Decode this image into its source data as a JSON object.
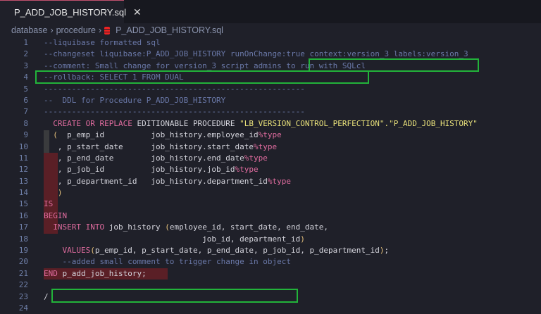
{
  "tab": {
    "title": "P_ADD_JOB_HISTORY.sql",
    "close": "✕"
  },
  "breadcrumb": [
    "database",
    "procedure",
    "P_ADD_JOB_HISTORY.sql"
  ],
  "lines": [
    [
      [
        "--liquibase formatted sql",
        "cm"
      ]
    ],
    [
      [
        "--changeset liquibase:P_ADD_JOB_HISTORY runOnChange:true context:version_3 labels:version_3",
        "cm"
      ]
    ],
    [
      [
        "--comment: Small change for version_3 script admins to run with SQLcl",
        "cm"
      ]
    ],
    [
      [
        "--rollback: SELECT 1 FROM DUAL",
        "cm"
      ]
    ],
    [
      [
        "--------------------------------------------------------",
        "cm"
      ]
    ],
    [
      [
        "--  DDL for Procedure P_ADD_JOB_HISTORY",
        "cm"
      ]
    ],
    [
      [
        "--------------------------------------------------------",
        "cm"
      ]
    ],
    [
      [
        "  ",
        "tx"
      ],
      [
        "CREATE OR REPLACE ",
        "kw"
      ],
      [
        "EDITIONABLE PROCEDURE ",
        "tx"
      ],
      [
        "\"LB_VERSION_CONTROL_PERFECTION\".\"P_ADD_JOB_HISTORY\"",
        "str"
      ]
    ],
    [
      [
        "  ",
        "tx"
      ],
      [
        "(",
        "pn"
      ],
      [
        "  p_emp_id          job_history.employee_id",
        "tx"
      ],
      [
        "%type",
        "kw"
      ]
    ],
    [
      [
        "   , p_start_date      job_history.start_date",
        "tx"
      ],
      [
        "%type",
        "kw"
      ]
    ],
    [
      [
        "   , p_end_date        job_history.end_date",
        "tx"
      ],
      [
        "%type",
        "kw"
      ]
    ],
    [
      [
        "   , p_job_id          job_history.job_id",
        "tx"
      ],
      [
        "%type",
        "kw"
      ]
    ],
    [
      [
        "   , p_department_id   job_history.department_id",
        "tx"
      ],
      [
        "%type",
        "kw"
      ]
    ],
    [
      [
        "   ",
        "tx"
      ],
      [
        ")",
        "pn"
      ]
    ],
    [
      [
        "IS",
        "kw"
      ]
    ],
    [
      [
        "BEGIN",
        "kw"
      ]
    ],
    [
      [
        "  ",
        "tx"
      ],
      [
        "INSERT INTO ",
        "kw"
      ],
      [
        "job_history ",
        "tx"
      ],
      [
        "(",
        "pn"
      ],
      [
        "employee_id, start_date, end_date,",
        "tx"
      ]
    ],
    [
      [
        "                                  job_id, department_id",
        "tx"
      ],
      [
        ")",
        "pn"
      ]
    ],
    [
      [
        "    ",
        "tx"
      ],
      [
        "VALUES",
        "kw"
      ],
      [
        "(",
        "pn"
      ],
      [
        "p_emp_id, p_start_date, p_end_date, p_job_id, p_department_id",
        "tx"
      ],
      [
        ")",
        "pn"
      ],
      [
        ";",
        "tx"
      ]
    ],
    [
      [
        "    --added small comment to trigger change in object",
        "cm"
      ]
    ],
    [
      [
        "END ",
        "kw"
      ],
      [
        "p_add_job_history;",
        "tx"
      ]
    ],
    [
      [
        "",
        "tx"
      ]
    ],
    [
      [
        "/",
        "tx"
      ]
    ],
    [
      [
        "",
        "tx"
      ]
    ]
  ],
  "colors": {
    "highlight": "#22b33a",
    "keyword": "#e06c9f",
    "comment": "#6a78a8"
  }
}
